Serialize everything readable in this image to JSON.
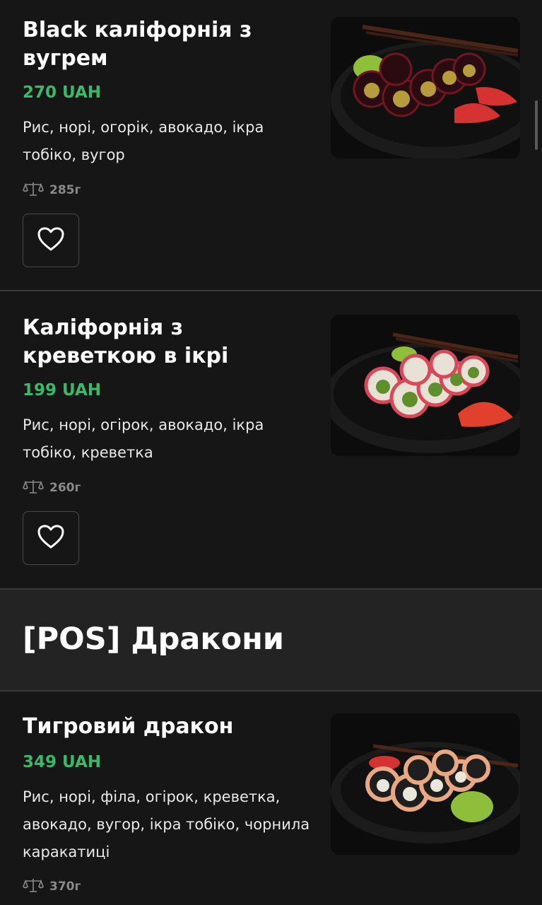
{
  "products": [
    {
      "name": "Black каліфорнія з вугрем",
      "price": "270 UAH",
      "description": "Рис, норі, огорік, авокадо, ікра тобіко, вугор",
      "weight": "285г"
    },
    {
      "name": "Каліфорнія з креветкою в ікрі",
      "price": "199 UAH",
      "description": "Рис, норі, огірок, авокадо, ікра тобіко, креветка",
      "weight": "260г"
    },
    {
      "name": "Тигровий дракон",
      "price": "349 UAH",
      "description": "Рис, норі, філа, огірок, креветка, авокадо, вугор, ікра тобіко, чорнила каракатиці",
      "weight": "370г"
    }
  ],
  "category": {
    "title": "[POS] Дракони"
  },
  "colors": {
    "background": "#161616",
    "price_green": "#3cb86a",
    "category_band": "#232323",
    "divider": "#3a3a3a"
  },
  "icons": {
    "weight": "scale-icon",
    "favorite": "heart-icon"
  }
}
